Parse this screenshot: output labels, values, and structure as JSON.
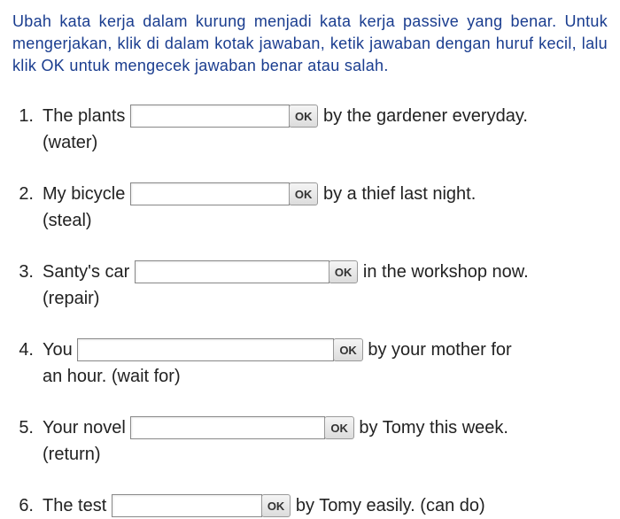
{
  "instructions": "Ubah kata kerja dalam kurung menjadi kata kerja passive yang benar. Untuk mengerjakan, klik di dalam kotak jawaban, ketik jawaban dengan huruf kecil, lalu klik OK untuk mengecek jawaban benar atau salah.",
  "ok_label": "OK",
  "questions": [
    {
      "num": "1.",
      "before": "The plants ",
      "after": " by the gardener everyday.",
      "hint": "(water)",
      "input_width": 180
    },
    {
      "num": "2.",
      "before": "My bicycle ",
      "after": " by a thief last night.",
      "hint": "(steal)",
      "input_width": 180
    },
    {
      "num": "3.",
      "before": "Santy's car ",
      "after": " in the workshop now.",
      "hint": "(repair)",
      "input_width": 220
    },
    {
      "num": "4.",
      "before": "You ",
      "after": " by your mother for",
      "hint": "an hour. (wait for)",
      "input_width": 290
    },
    {
      "num": "5.",
      "before": "Your novel ",
      "after": " by Tomy this week.",
      "hint": "(return)",
      "input_width": 220
    },
    {
      "num": "6.",
      "before": "The test ",
      "after": " by Tomy easily. (can do)",
      "hint": "",
      "input_width": 170
    }
  ]
}
